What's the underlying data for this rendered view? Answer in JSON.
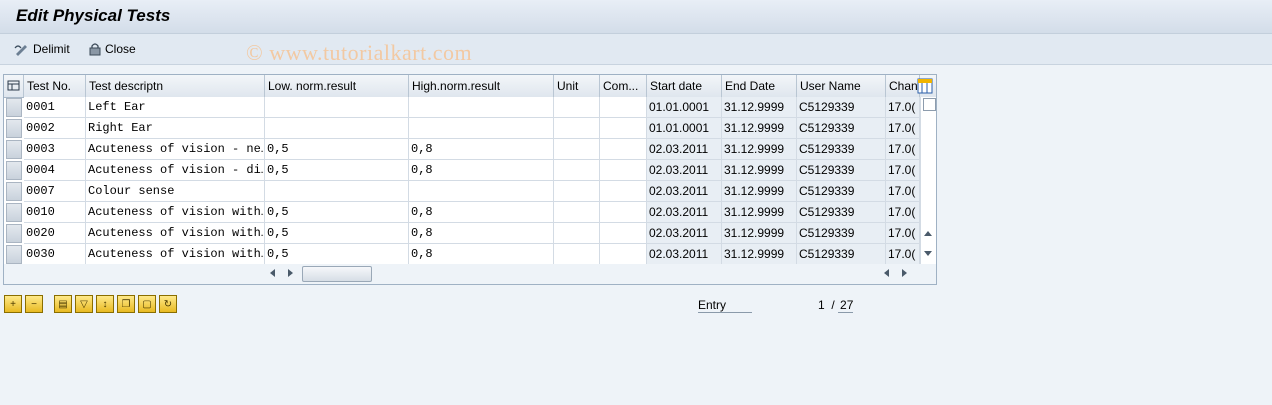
{
  "title": "Edit Physical Tests",
  "toolbar": {
    "delimit_label": "Delimit",
    "close_label": "Close",
    "delimit_icon": "pencil-delimit-icon",
    "close_icon": "lock-icon"
  },
  "watermark": "© www.tutorialkart.com",
  "table": {
    "columns": [
      "Test No.",
      "Test descriptn",
      "Low. norm.result",
      "High.norm.result",
      "Unit",
      "Com...",
      "Start date",
      "End Date",
      "User Name",
      "Chan"
    ],
    "rows": [
      [
        "0001",
        "Left Ear",
        "",
        "",
        "",
        "",
        "01.01.0001",
        "31.12.9999",
        "C5129339",
        "17.0("
      ],
      [
        "0002",
        "Right Ear",
        "",
        "",
        "",
        "",
        "01.01.0001",
        "31.12.9999",
        "C5129339",
        "17.0("
      ],
      [
        "0003",
        "Acuteness of vision - ne…",
        "0,5",
        "0,8",
        "",
        "",
        "02.03.2011",
        "31.12.9999",
        "C5129339",
        "17.0("
      ],
      [
        "0004",
        "Acuteness of vision - di…",
        "0,5",
        "0,8",
        "",
        "",
        "02.03.2011",
        "31.12.9999",
        "C5129339",
        "17.0("
      ],
      [
        "0007",
        "Colour sense",
        "",
        "",
        "",
        "",
        "02.03.2011",
        "31.12.9999",
        "C5129339",
        "17.0("
      ],
      [
        "0010",
        "Acuteness of vision with…",
        "0,5",
        "0,8",
        "",
        "",
        "02.03.2011",
        "31.12.9999",
        "C5129339",
        "17.0("
      ],
      [
        "0020",
        "Acuteness of vision with…",
        "0,5",
        "0,8",
        "",
        "",
        "02.03.2011",
        "31.12.9999",
        "C5129339",
        "17.0("
      ],
      [
        "0030",
        "Acuteness of vision with…",
        "0,5",
        "0,8",
        "",
        "",
        "02.03.2011",
        "31.12.9999",
        "C5129339",
        "17.0("
      ]
    ]
  },
  "footer": {
    "entry_label": "Entry",
    "page_current": "1",
    "page_separator": "/",
    "page_total": "27",
    "icons": [
      "insert-row-icon",
      "delete-row-icon",
      "select-all-icon",
      "filter-icon",
      "sort-icon",
      "copy-icon",
      "paste-icon",
      "refresh-icon"
    ]
  },
  "colors": {
    "background": "#eef3f8",
    "watermark": "#f2c9a3",
    "readonly_cell": "#e8eef4"
  }
}
